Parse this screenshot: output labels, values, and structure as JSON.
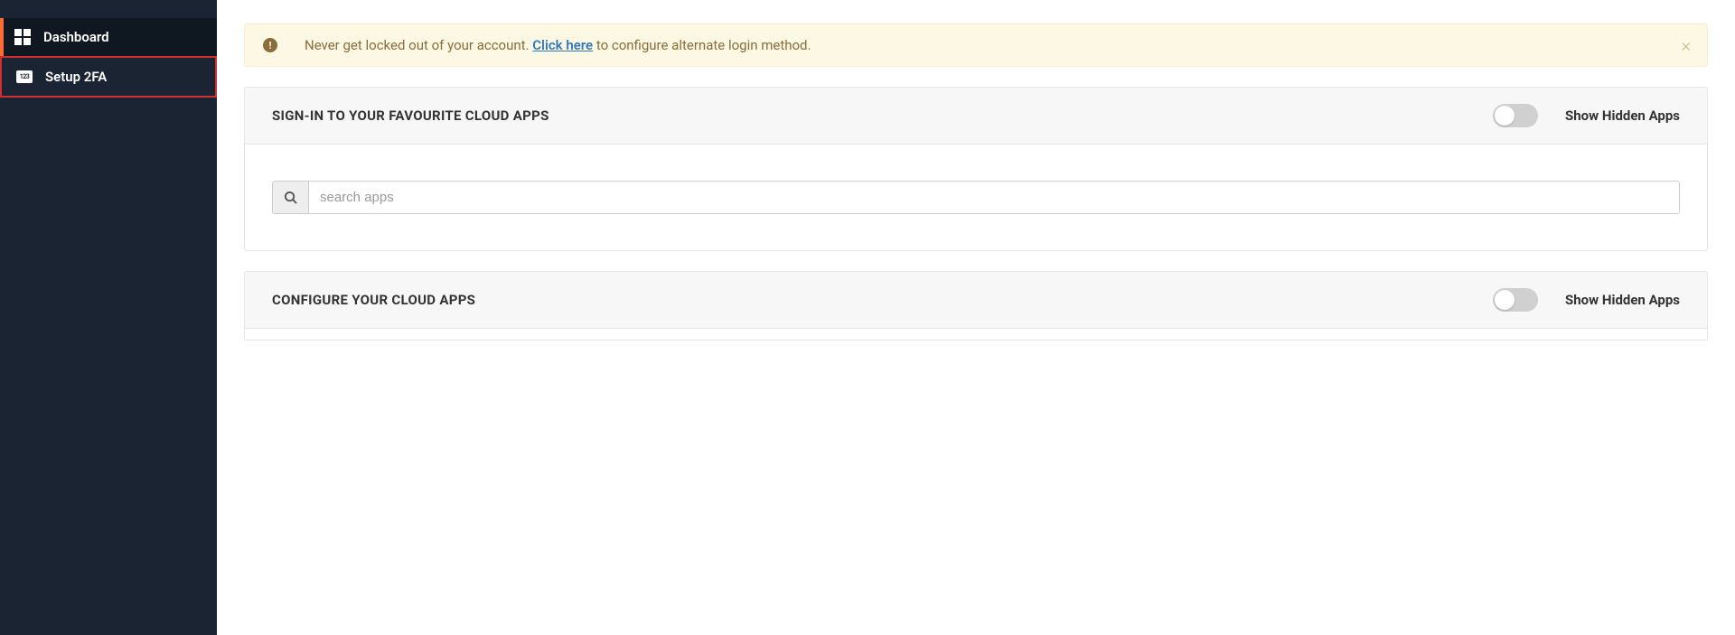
{
  "sidebar": {
    "items": [
      {
        "label": "Dashboard"
      },
      {
        "label": "Setup 2FA"
      }
    ],
    "twofa_icon_text": "123"
  },
  "alert": {
    "text_before": "Never get locked out of your account. ",
    "link_text": "Click here",
    "text_after": " to configure alternate login method.",
    "close_glyph": "×",
    "icon_glyph": "!"
  },
  "panels": {
    "signin": {
      "title": "SIGN-IN TO YOUR FAVOURITE CLOUD APPS",
      "toggle_label": "Show Hidden Apps",
      "search_placeholder": "search apps"
    },
    "configure": {
      "title": "CONFIGURE YOUR CLOUD APPS",
      "toggle_label": "Show Hidden Apps"
    }
  }
}
